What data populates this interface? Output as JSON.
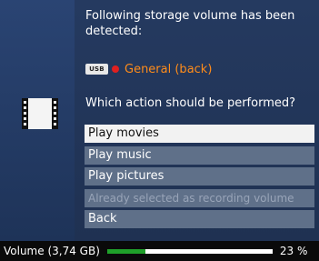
{
  "dialog": {
    "message": "Following storage volume has been detected:",
    "device": {
      "icon": "usb-icon",
      "icon_text": "USB",
      "status_icon": "red-dot-icon",
      "name": "General (back)",
      "name_color": "#ff8c1a"
    },
    "question": "Which action should be performed?",
    "side_icon": "film-strip-icon"
  },
  "menu": {
    "items": [
      {
        "label": "Play movies",
        "state": "selected"
      },
      {
        "label": "Play music",
        "state": "normal"
      },
      {
        "label": "Play pictures",
        "state": "normal"
      },
      {
        "label": "Already selected as recording volume",
        "state": "disabled"
      },
      {
        "label": "Back",
        "state": "normal"
      }
    ]
  },
  "status": {
    "volume_label": "Volume (3,74 GB)",
    "usage_percent": 23,
    "usage_text": "23 %",
    "bar_color": "#1fa02a"
  }
}
